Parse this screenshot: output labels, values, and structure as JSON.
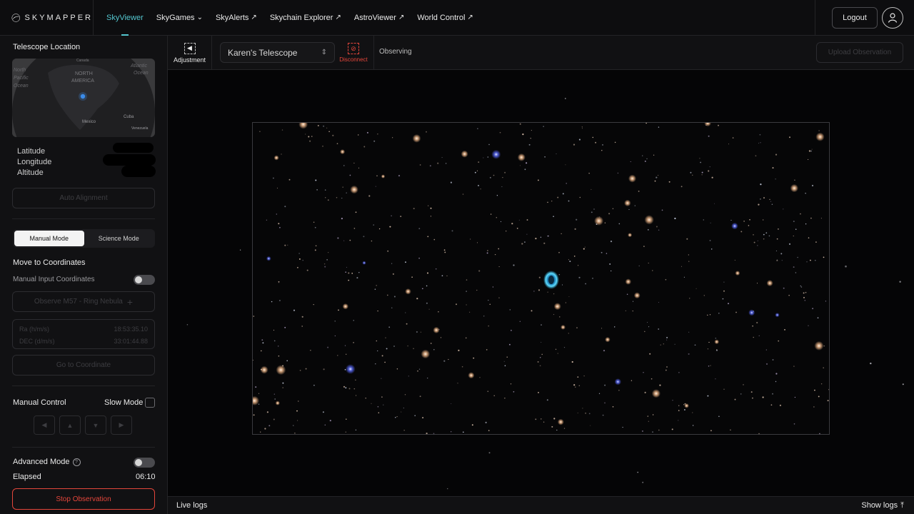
{
  "brand": {
    "name": "SKYMAPPER"
  },
  "nav": {
    "items": [
      {
        "label": "SkyViewer",
        "glyph": "",
        "active": true
      },
      {
        "label": "SkyGames",
        "glyph": "⌄",
        "active": false
      },
      {
        "label": "SkyAlerts",
        "glyph": "↗",
        "active": false
      },
      {
        "label": "Skychain Explorer",
        "glyph": "↗",
        "active": false
      },
      {
        "label": "AstroViewer",
        "glyph": "↗",
        "active": false
      },
      {
        "label": "World Control",
        "glyph": "↗",
        "active": false
      }
    ],
    "logout_label": "Logout"
  },
  "sidebar": {
    "location_title": "Telescope Location",
    "map": {
      "labels": [
        "North",
        "Pacific",
        "Ocean",
        "NORTH",
        "AMERICA",
        "Atlantic",
        "Ocean",
        "Canada",
        "Cuba",
        "Mexico",
        "Venezuela"
      ]
    },
    "location_labels": [
      "Latitude",
      "Longitude",
      "Altitude"
    ],
    "auto_alignment_label": "Auto Alignment",
    "modes": [
      "Manual Mode",
      "Science Mode"
    ],
    "move_title": "Move to Coordinates",
    "manual_input_label": "Manual Input Coordinates",
    "observe_label": "Observe M57 - Ring Nebula",
    "ra_label": "Ra (h/m/s)",
    "ra_value": "18:53:35.10",
    "dec_label": "DEC (d/m/s)",
    "dec_value": "33:01:44.88",
    "goto_label": "Go to Coordinate",
    "manual_control_label": "Manual Control",
    "slow_mode_label": "Slow Mode",
    "advanced_mode_label": "Advanced Mode",
    "elapsed_label": "Elapsed",
    "elapsed_value": "06:10",
    "stop_label": "Stop Observation"
  },
  "toolbar": {
    "adjustment_label": "Adjustment",
    "telescope_selected": "Karen's Telescope",
    "disconnect_label": "Disconnect",
    "status": "Observing",
    "upload_label": "Upload Observation"
  },
  "footer": {
    "live_logs_label": "Live logs",
    "show_logs_label": "Show logs"
  },
  "colors": {
    "accent": "#54c6cf",
    "danger": "#e4463b",
    "nebula": "#2fb8e8"
  }
}
